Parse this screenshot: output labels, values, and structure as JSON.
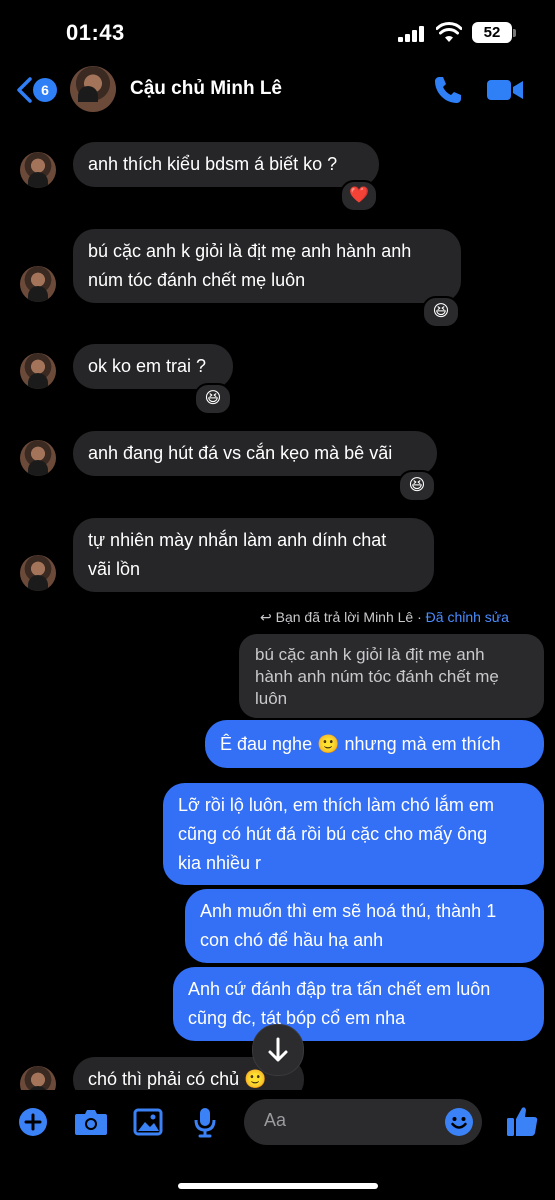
{
  "status": {
    "time": "01:43",
    "battery": "52"
  },
  "header": {
    "back_count": "6",
    "contact_name": "Cậu chủ Minh Lê"
  },
  "messages": {
    "m1": {
      "text": "anh thích kiểu bdsm á biết ko ?",
      "reaction": "❤️"
    },
    "m2": {
      "line1": "bú cặc anh k giỏi là địt mẹ anh hành anh",
      "line2": "núm tóc đánh chết mẹ luôn",
      "reaction": "😆"
    },
    "m3": {
      "text": "ok ko em trai ?",
      "reaction": "😆"
    },
    "m4": {
      "text": "anh đang hút đá vs cắn kẹo mà bê vãi",
      "reaction": "😆"
    },
    "m5": {
      "line1": "tự nhiên mày nhắn làm anh dính chat",
      "line2": "vãi lồn"
    },
    "reply_note": {
      "text": "Bạn đã trả lời Minh Lê · ",
      "edited": "Đã chỉnh sửa"
    },
    "quoted": {
      "line1": "bú cặc anh k giỏi là địt mẹ anh",
      "line2": "hành anh núm tóc đánh chết mẹ",
      "line3": "luôn"
    },
    "o1": {
      "text": "Ê đau nghe 🙂 nhưng mà em thích"
    },
    "o2": {
      "line1": "Lỡ rồi lộ luôn, em thích làm chó lắm em",
      "line2": "cũng có hút đá rồi bú cặc cho mấy ông",
      "line3": "kia nhiều r"
    },
    "o3": {
      "line1": "Anh muốn thì em sẽ hoá thú, thành 1",
      "line2": "con chó để hầu hạ anh"
    },
    "o4": {
      "line1": "Anh cứ đánh đập tra tấn chết em luôn",
      "line2": "cũng đc, tát bóp cổ em nha"
    },
    "m6": {
      "text": "chó thì phải có chủ 🙂"
    }
  },
  "composer": {
    "placeholder": "Aa"
  },
  "colors": {
    "accent": "#3470f6",
    "incoming": "#262628",
    "background": "#000000"
  }
}
